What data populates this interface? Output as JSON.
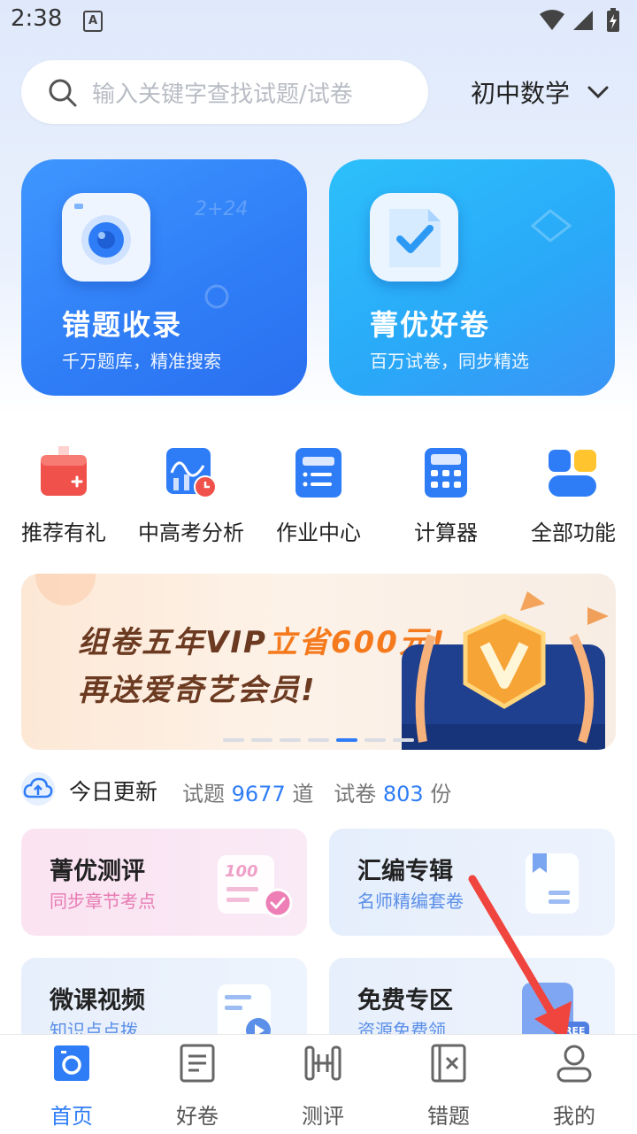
{
  "status_bar": {
    "time": "2:38",
    "a_badge": "A"
  },
  "search": {
    "placeholder": "输入关键字查找试题/试卷",
    "icon": "search-icon"
  },
  "subject": {
    "label": "初中数学",
    "icon": "chevron-down-icon"
  },
  "hero_cards": [
    {
      "title": "错题收录",
      "subtitle": "千万题库，精准搜索",
      "icon": "camera-icon",
      "color": "#2f7df6"
    },
    {
      "title": "菁优好卷",
      "subtitle": "百万试卷，同步精选",
      "icon": "checked-paper-icon",
      "color": "#2aa8f8"
    }
  ],
  "quick_actions": [
    {
      "label": "推荐有礼",
      "icon": "gift-icon"
    },
    {
      "label": "中高考分析",
      "icon": "analysis-chart-icon"
    },
    {
      "label": "作业中心",
      "icon": "homework-list-icon"
    },
    {
      "label": "计算器",
      "icon": "calculator-icon"
    },
    {
      "label": "全部功能",
      "icon": "all-functions-icon"
    }
  ],
  "banner": {
    "line1_a": "组卷五年VIP",
    "line1_b": "立省600元!",
    "line2": "再送爱奇艺会员!",
    "active_dot": 5,
    "dot_count": 7
  },
  "today_update": {
    "title": "今日更新",
    "questions_label": "试题",
    "questions_count": "9677",
    "questions_unit": "道",
    "papers_label": "试卷",
    "papers_count": "803",
    "papers_unit": "份"
  },
  "feature_cards": [
    {
      "title": "菁优测评",
      "subtitle": "同步章节考点",
      "subtitle_color": "#e77bb4"
    },
    {
      "title": "汇编专辑",
      "subtitle": "名师精编套卷",
      "subtitle_color": "#5b8fe8"
    },
    {
      "title": "微课视频",
      "subtitle": "知识点点拨",
      "subtitle_color": "#5b8fe8"
    },
    {
      "title": "免费专区",
      "subtitle": "资源免费领",
      "subtitle_color": "#5b8fe8"
    }
  ],
  "free_badge": "FREE",
  "tab_bar": [
    {
      "label": "首页",
      "icon": "home-camera-icon",
      "active": true
    },
    {
      "label": "好卷",
      "icon": "paper-icon",
      "active": false
    },
    {
      "label": "测评",
      "icon": "dumbbell-icon",
      "active": false
    },
    {
      "label": "错题",
      "icon": "wrong-question-icon",
      "active": false
    },
    {
      "label": "我的",
      "icon": "profile-icon",
      "active": false
    }
  ],
  "colors": {
    "accent": "#2f7df6",
    "annotation_arrow": "#f0453f"
  }
}
